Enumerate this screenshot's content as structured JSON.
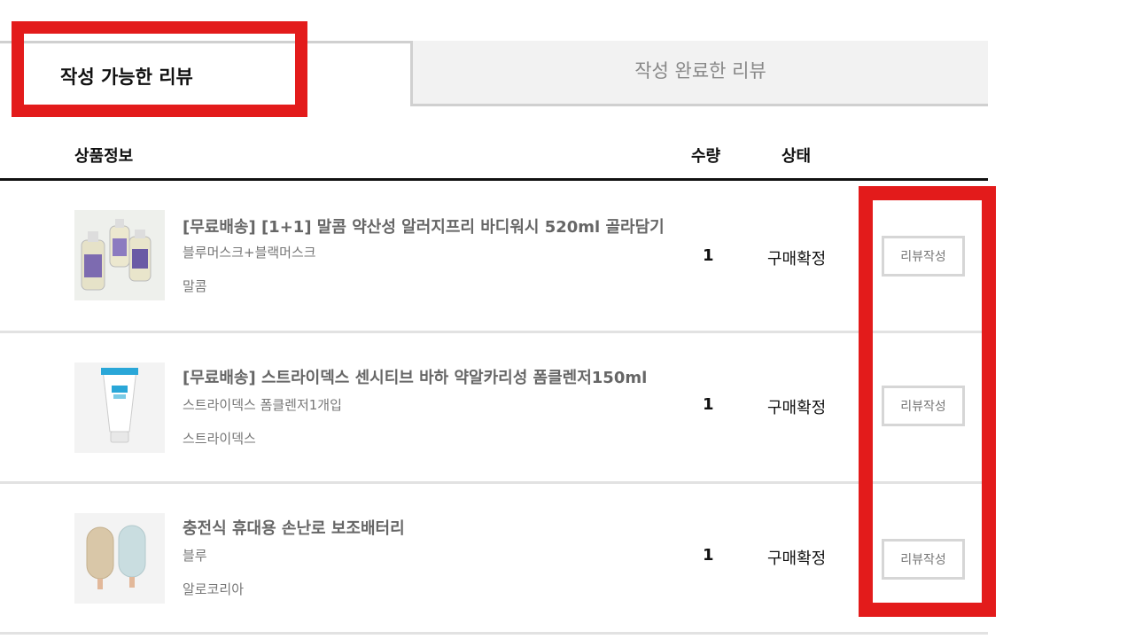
{
  "tabs": {
    "writable": "작성 가능한 리뷰",
    "completed": "작성 완료한 리뷰"
  },
  "table": {
    "headers": {
      "info": "상품정보",
      "qty": "수량",
      "status": "상태"
    }
  },
  "items": [
    {
      "name": "[무료배송] [1+1] 말콤 약산성 알러지프리 바디워시 520ml 골라담기",
      "option": "블루머스크+블랙머스크",
      "brand": "말콤",
      "qty": "1",
      "status": "구매확정",
      "action": "리뷰작성"
    },
    {
      "name": "[무료배송] 스트라이덱스 센시티브 바하 약알카리성 폼클렌저150ml",
      "option": "스트라이덱스 폼클렌저1개입",
      "brand": "스트라이덱스",
      "qty": "1",
      "status": "구매확정",
      "action": "리뷰작성"
    },
    {
      "name": "충전식 휴대용 손난로 보조배터리",
      "option": "블루",
      "brand": "알로코리아",
      "qty": "1",
      "status": "구매확정",
      "action": "리뷰작성"
    }
  ],
  "colors": {
    "highlight": "#e31b1b",
    "border": "#d0d0d0",
    "tab_bg": "#f2f2f2"
  }
}
